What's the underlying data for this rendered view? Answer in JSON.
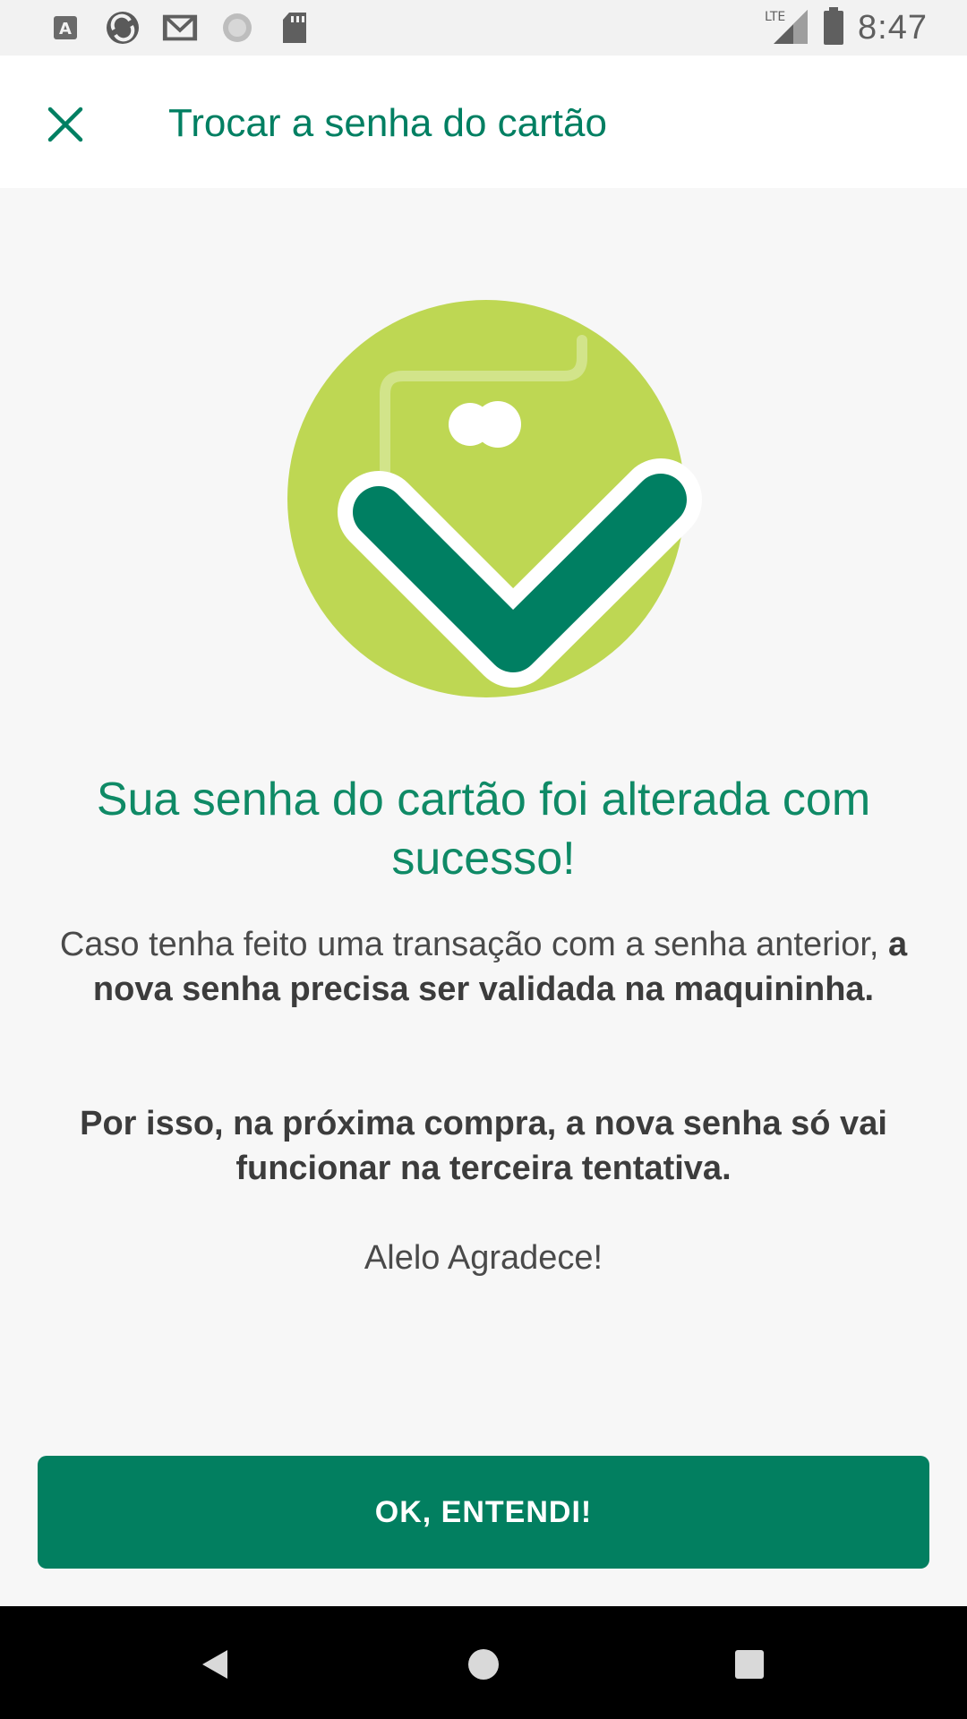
{
  "status_bar": {
    "time": "8:47",
    "network": "LTE",
    "icons": [
      "font-app-icon",
      "sync-app-icon",
      "gmail-icon",
      "loading-icon",
      "sd-card-icon"
    ]
  },
  "app_bar": {
    "title": "Trocar a senha do cartão",
    "close_icon": "close-icon"
  },
  "illustration": {
    "icon": "card-check-icon",
    "colors": {
      "circle": "#bed753",
      "check": "#007f62",
      "outline": "#ffffff"
    }
  },
  "content": {
    "headline": "Sua senha do cartão foi alterada com sucesso!",
    "message_part1": "Caso tenha feito uma transação com a senha anterior, ",
    "message_part2_bold": "a nova senha precisa ser validada na maquininha.",
    "message2": "Por isso, na próxima compra, a nova senha só vai funcionar na terceira tentativa.",
    "thanks": "Alelo Agradece!"
  },
  "actions": {
    "ok_label": "OK, ENTENDI!"
  },
  "nav_bar": {
    "buttons": [
      "back-icon",
      "home-icon",
      "recents-icon"
    ]
  },
  "colors": {
    "brand_green": "#007f62",
    "light_green": "#bed753",
    "background": "#f7f7f7"
  }
}
